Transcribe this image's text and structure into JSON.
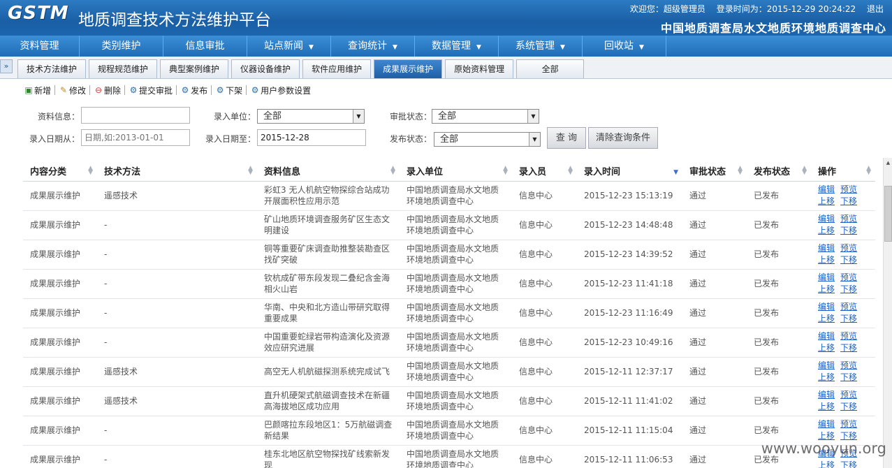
{
  "header": {
    "logo": "GSTM",
    "title": "地质调查技术方法维护平台",
    "welcome": "欢迎您：超级管理员",
    "login_time": "登录时间为：2015-12-29 20:24:22",
    "logout": "退出",
    "subtitle": "中国地质调查局水文地质环境地质调查中心"
  },
  "mainnav": [
    {
      "label": "资料管理",
      "caret": false
    },
    {
      "label": "类别维护",
      "caret": false
    },
    {
      "label": "信息审批",
      "caret": false
    },
    {
      "label": "站点新闻",
      "caret": true
    },
    {
      "label": "查询统计",
      "caret": true
    },
    {
      "label": "数据管理",
      "caret": true
    },
    {
      "label": "系统管理",
      "caret": true
    },
    {
      "label": "回收站",
      "caret": true
    }
  ],
  "tabs": [
    {
      "label": "技术方法维护"
    },
    {
      "label": "规程规范维护"
    },
    {
      "label": "典型案例维护"
    },
    {
      "label": "仪器设备维护"
    },
    {
      "label": "软件应用维护"
    },
    {
      "label": "成果展示维护",
      "active": true
    },
    {
      "label": "原始资料管理"
    },
    {
      "label": "全部"
    }
  ],
  "toolbar": {
    "new": "新增",
    "edit": "修改",
    "delete": "删除",
    "submit": "提交审批",
    "publish": "发布",
    "unpublish": "下架",
    "user_params": "用户参数设置"
  },
  "filters": {
    "info_label": "资料信息：",
    "info_value": "",
    "unit_label": "录入单位：",
    "unit_value": "全部",
    "approval_label": "审批状态：",
    "approval_value": "全部",
    "date_from_label": "录入日期从：",
    "date_from_placeholder": "日期,如:2013-01-01",
    "date_to_label": "录入日期至：",
    "date_to_value": "2015-12-28",
    "publish_label": "发布状态：",
    "publish_value": "全部",
    "query_button": "查 询",
    "clear_button": "清除查询条件"
  },
  "table": {
    "columns": [
      "内容分类",
      "技术方法",
      "资料信息",
      "录入单位",
      "录入员",
      "录入时间",
      "审批状态",
      "发布状态",
      "操作"
    ],
    "op_labels": {
      "edit": "编辑",
      "preview": "预览",
      "up": "上移",
      "down": "下移"
    },
    "rows": [
      {
        "category": "成果展示维护",
        "method": "遥感技术",
        "info": "彩虹3 无人机航空物探综合站成功开展面积性应用示范",
        "unit": "中国地质调查局水文地质环境地质调查中心",
        "user": "信息中心",
        "time": "2015-12-23 15:13:19",
        "approval": "通过",
        "publish": "已发布"
      },
      {
        "category": "成果展示维护",
        "method": "-",
        "info": "矿山地质环境调查服务矿区生态文明建设",
        "unit": "中国地质调查局水文地质环境地质调查中心",
        "user": "信息中心",
        "time": "2015-12-23 14:48:48",
        "approval": "通过",
        "publish": "已发布"
      },
      {
        "category": "成果展示维护",
        "method": "-",
        "info": "铜等重要矿床调查助推整装勘查区找矿突破",
        "unit": "中国地质调查局水文地质环境地质调查中心",
        "user": "信息中心",
        "time": "2015-12-23 14:39:52",
        "approval": "通过",
        "publish": "已发布"
      },
      {
        "category": "成果展示维护",
        "method": "-",
        "info": "钦杭成矿带东段发现二叠纪含金海相火山岩",
        "unit": "中国地质调查局水文地质环境地质调查中心",
        "user": "信息中心",
        "time": "2015-12-23 11:41:18",
        "approval": "通过",
        "publish": "已发布"
      },
      {
        "category": "成果展示维护",
        "method": "-",
        "info": "华南、中央和北方造山带研究取得重要成果",
        "unit": "中国地质调查局水文地质环境地质调查中心",
        "user": "信息中心",
        "time": "2015-12-23 11:16:49",
        "approval": "通过",
        "publish": "已发布"
      },
      {
        "category": "成果展示维护",
        "method": "-",
        "info": "中国重要蛇绿岩带构造演化及资源效应研究进展",
        "unit": "中国地质调查局水文地质环境地质调查中心",
        "user": "信息中心",
        "time": "2015-12-23 10:49:16",
        "approval": "通过",
        "publish": "已发布"
      },
      {
        "category": "成果展示维护",
        "method": "遥感技术",
        "info": "高空无人机航磁探测系统完成试飞",
        "unit": "中国地质调查局水文地质环境地质调查中心",
        "user": "信息中心",
        "time": "2015-12-11 12:37:17",
        "approval": "通过",
        "publish": "已发布"
      },
      {
        "category": "成果展示维护",
        "method": "遥感技术",
        "info": "直升机硬架式航磁调查技术在新疆高海拔地区成功应用",
        "unit": "中国地质调查局水文地质环境地质调查中心",
        "user": "信息中心",
        "time": "2015-12-11 11:41:02",
        "approval": "通过",
        "publish": "已发布"
      },
      {
        "category": "成果展示维护",
        "method": "-",
        "info": "巴颜喀拉东段地区1：5万航磁调查新结果",
        "unit": "中国地质调查局水文地质环境地质调查中心",
        "user": "信息中心",
        "time": "2015-12-11 11:15:04",
        "approval": "通过",
        "publish": "已发布"
      },
      {
        "category": "成果展示维护",
        "method": "-",
        "info": "桂东北地区航空物探找矿线索新发现",
        "unit": "中国地质调查局水文地质环境地质调查中心",
        "user": "信息中心",
        "time": "2015-12-11 11:06:53",
        "approval": "通过",
        "publish": "已发布"
      }
    ]
  },
  "watermark": "www.wooyun.org"
}
